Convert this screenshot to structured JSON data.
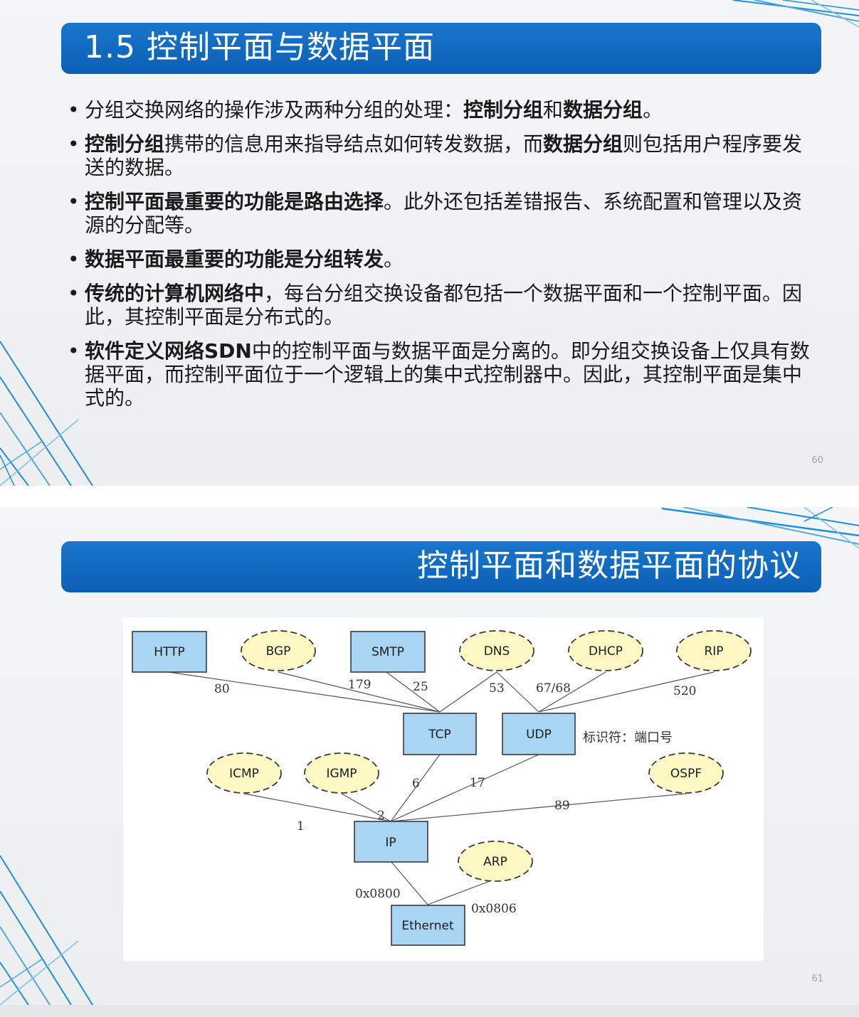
{
  "slide1": {
    "title": "1.5  控制平面与数据平面",
    "page_number": "60",
    "bullet_symbol": "•",
    "bullets": [
      {
        "b0": "",
        "t0": "分组交换网络的操作涉及两种分组的处理：",
        "b1": "控制分组",
        "t1": "和",
        "b2": "数据分组",
        "t2": "。"
      },
      {
        "b0": "控制分组",
        "t0": "携带的信息用来指导结点如何转发数据，而",
        "b1": "数据分组",
        "t1": "则包括用户程序要发送的数据。",
        "b2": "",
        "t2": ""
      },
      {
        "b0": "控制平面最重要的功能是路由选择",
        "t0": "。此外还包括差错报告、系统配置和管理以及资源的分配等。",
        "b1": "",
        "t1": "",
        "b2": "",
        "t2": ""
      },
      {
        "b0": "数据平面最重要的功能是分组转发",
        "t0": "。",
        "b1": "",
        "t1": "",
        "b2": "",
        "t2": ""
      },
      {
        "b0": "传统的计算机网络中",
        "t0": "，每台分组交换设备都包括一个数据平面和一个控制平面。因此，其控制平面是分布式的。",
        "b1": "",
        "t1": "",
        "b2": "",
        "t2": ""
      },
      {
        "b0": "软件定义网络SDN",
        "t0": "中的控制平面与数据平面是分离的。即分组交换设备上仅具有数据平面，而控制平面位于一个逻辑上的集中式控制器中。因此，其控制平面是集中式的。",
        "b1": "",
        "t1": "",
        "b2": "",
        "t2": ""
      }
    ]
  },
  "slide2": {
    "title": "控制平面和数据平面的协议",
    "page_number": "61",
    "diagram": {
      "nodes": {
        "http": "HTTP",
        "bgp": "BGP",
        "smtp": "SMTP",
        "dns": "DNS",
        "dhcp": "DHCP",
        "rip": "RIP",
        "tcp": "TCP",
        "udp": "UDP",
        "icmp": "ICMP",
        "igmp": "IGMP",
        "ospf": "OSPF",
        "ip": "IP",
        "arp": "ARP",
        "ethernet": "Ethernet"
      },
      "ports": {
        "http_tcp": "80",
        "bgp_tcp": "179",
        "smtp_tcp": "25",
        "dns_tcp": "53",
        "dhcp_udp": "67/68",
        "rip_udp": "520",
        "tcp_ip": "6",
        "udp_ip": "17",
        "icmp_ip": "1",
        "igmp_ip": "2",
        "ospf_ip": "89",
        "ip_eth": "0x0800",
        "arp_eth": "0x0806"
      },
      "note": "标识符：端口号"
    }
  },
  "colors": {
    "title_bar": "#0b60b5",
    "box_fill": "#a9d5f5",
    "box_border": "#3a3a3a",
    "ellipse_fill": "#fdf7c4",
    "deco_lines": "#1f8fd6"
  }
}
